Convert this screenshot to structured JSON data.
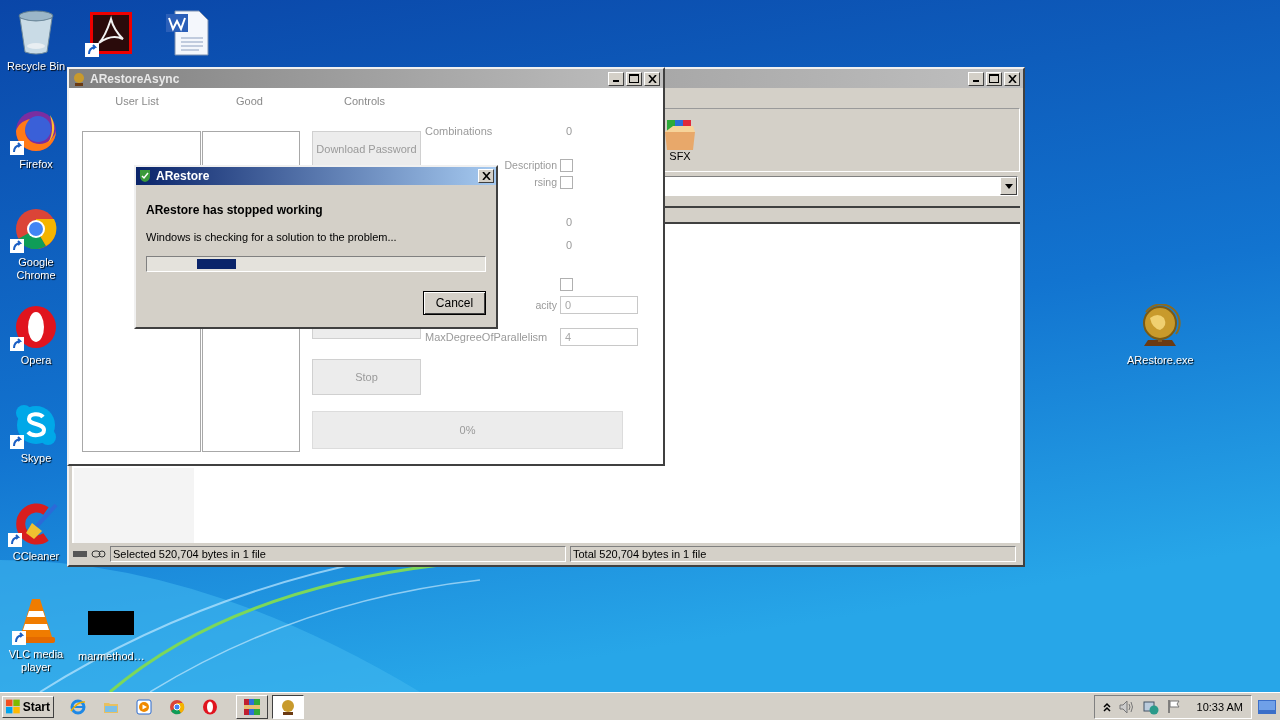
{
  "desktop": {
    "icons": [
      {
        "label": "Recycle Bin",
        "kind": "recycle",
        "shortcut": false
      },
      {
        "kind": "pdf",
        "shortcut": true
      },
      {
        "kind": "word",
        "shortcut": false
      },
      {
        "label": "Firefox",
        "kind": "firefox",
        "shortcut": true
      },
      {
        "label": "Google Chrome",
        "kind": "chrome",
        "shortcut": true
      },
      {
        "label": "Opera",
        "kind": "opera",
        "shortcut": true
      },
      {
        "label": "Skype",
        "kind": "skype",
        "shortcut": true
      },
      {
        "label": "CCleaner",
        "kind": "ccleaner",
        "shortcut": true
      },
      {
        "label": "VLC media player",
        "kind": "vlc",
        "shortcut": true
      },
      {
        "label": "marmethod…",
        "kind": "blackfile",
        "shortcut": false
      },
      {
        "label": "ARestore.exe",
        "kind": "globe",
        "shortcut": false
      }
    ]
  },
  "archiver_window": {
    "toolbar": [
      {
        "label": "SFX"
      }
    ],
    "status_bar": [
      "Selected 520,704 bytes in 1 file",
      "Total 520,704 bytes in 1 file"
    ]
  },
  "app_window": {
    "title": "ARestoreAsync",
    "headers": [
      "User List",
      "Good",
      "Controls"
    ],
    "buttons": [
      {
        "label": "Download Password"
      },
      {
        "label": "Stop"
      }
    ],
    "settings": [
      {
        "label": "Combinations",
        "kind": "value",
        "value": "0"
      },
      {
        "label": "Description",
        "kind": "checkbox",
        "checked": false
      },
      {
        "label": "rsing",
        "kind": "checkbox",
        "checked": false
      },
      {
        "kind": "value",
        "value": "0"
      },
      {
        "kind": "value",
        "value": "0"
      },
      {
        "kind": "checkbox",
        "checked": false
      },
      {
        "label": "acity",
        "kind": "field",
        "value": "0"
      },
      {
        "label": "MaxDegreeOfParallelism",
        "kind": "field",
        "value": "4"
      }
    ],
    "progress": {
      "text": "0%"
    }
  },
  "dialog": {
    "title": "ARestore",
    "heading": "ARestore has stopped working",
    "message": "Windows is checking for a solution to the problem...",
    "button": "Cancel"
  },
  "taskbar": {
    "start": "Start",
    "quick_launch": [
      {
        "kind": "ie"
      },
      {
        "kind": "explorer"
      },
      {
        "kind": "media"
      },
      {
        "kind": "chrome"
      },
      {
        "kind": "opera"
      }
    ],
    "tasks": [
      {
        "kind": "archive",
        "selected": false
      },
      {
        "kind": "globe",
        "selected": true
      }
    ],
    "clock": "10:33 AM"
  }
}
